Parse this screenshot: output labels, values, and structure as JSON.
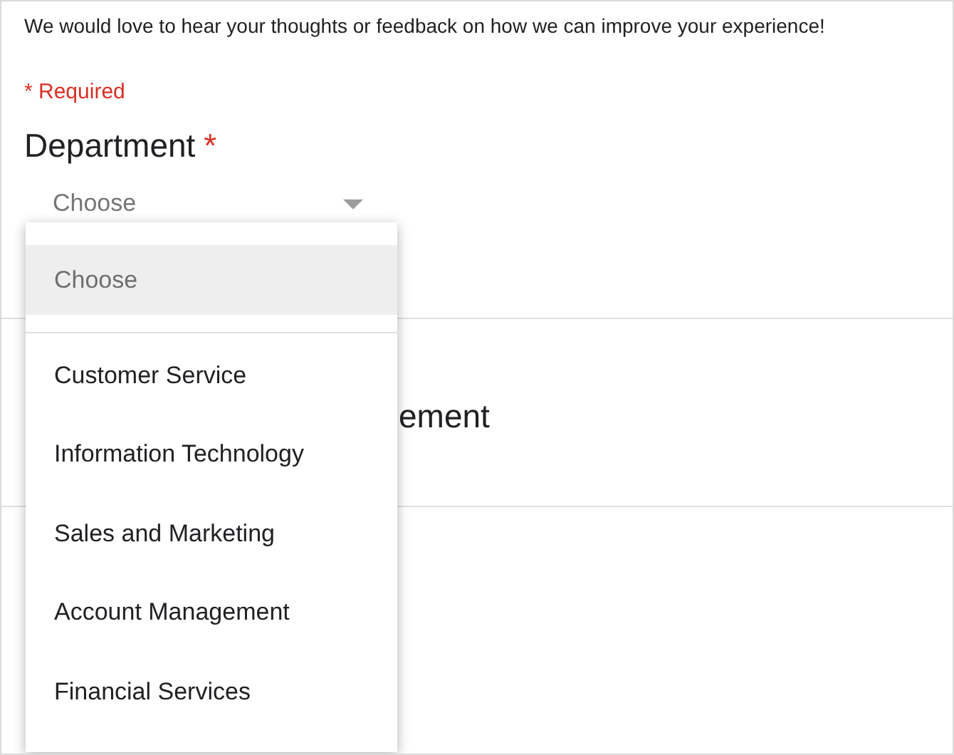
{
  "intro": "We would love to hear your thoughts or feedback on how we can improve your experience!",
  "required_note": "* Required",
  "question": {
    "title": "Department",
    "required_mark": "*",
    "select": {
      "value": "Choose"
    }
  },
  "menu": {
    "items": [
      {
        "label": "Choose",
        "kind": "placeholder",
        "selected": true
      },
      {
        "label": "Customer Service",
        "kind": "option",
        "selected": false
      },
      {
        "label": "Information Technology",
        "kind": "option",
        "selected": false
      },
      {
        "label": "Sales and Marketing",
        "kind": "option",
        "selected": false
      },
      {
        "label": "Account Management",
        "kind": "option",
        "selected": false
      },
      {
        "label": "Financial Services",
        "kind": "option",
        "selected": false
      }
    ]
  },
  "question_2": {
    "title": "ement"
  }
}
